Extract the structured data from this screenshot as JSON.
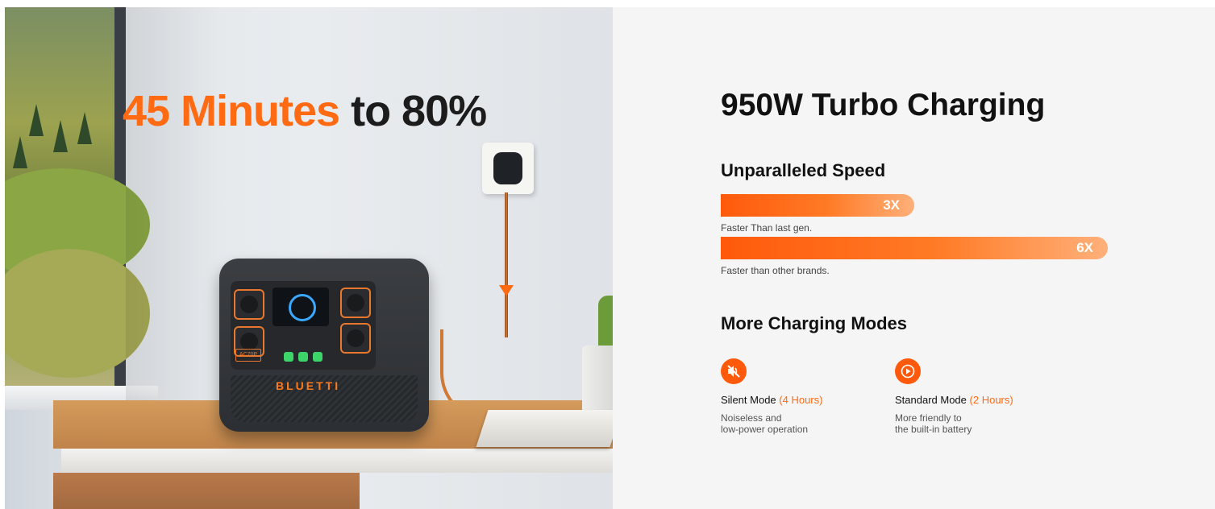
{
  "hero": {
    "headline_accent": "45 Minutes",
    "headline_rest": " to 80%",
    "brand": "BLUETTI",
    "model_label": "AC70P"
  },
  "panel": {
    "title": "950W Turbo Charging",
    "speed_heading": "Unparalleled Speed",
    "bars": [
      {
        "label": "3X",
        "caption": "Faster Than last gen.",
        "value_fraction": 0.5
      },
      {
        "label": "6X",
        "caption": "Faster than other brands.",
        "value_fraction": 1.0
      }
    ],
    "modes_heading": "More Charging Modes",
    "modes": [
      {
        "name": "Silent Mode",
        "hours": "(4 Hours)",
        "desc_line1": "Noiseless and",
        "desc_line2": "low-power operation",
        "icon": "muted-speaker-icon"
      },
      {
        "name": "Standard Mode",
        "hours": "(2 Hours)",
        "desc_line1": "More friendly to",
        "desc_line2": "the built-in battery",
        "icon": "play-circle-icon"
      }
    ]
  },
  "colors": {
    "accent": "#ff6a13",
    "panel_bg": "#f5f5f5",
    "text": "#111111"
  }
}
